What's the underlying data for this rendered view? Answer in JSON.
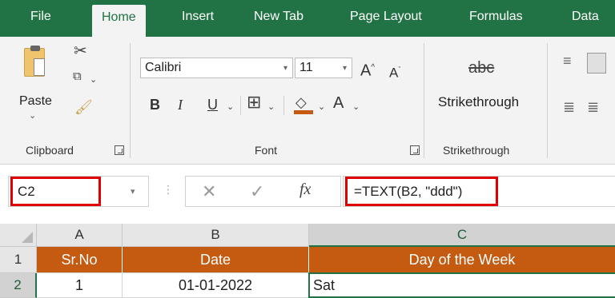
{
  "tabs": [
    {
      "label": "File",
      "active": false
    },
    {
      "label": "Home",
      "active": true
    },
    {
      "label": "Insert",
      "active": false
    },
    {
      "label": "New Tab",
      "active": false
    },
    {
      "label": "Page Layout",
      "active": false
    },
    {
      "label": "Formulas",
      "active": false
    },
    {
      "label": "Data",
      "active": false
    }
  ],
  "ribbon": {
    "clipboard": {
      "paste_label": "Paste",
      "group_label": "Clipboard"
    },
    "font": {
      "font_name": "Calibri",
      "font_size": "11",
      "group_label": "Font",
      "bold": "B",
      "italic": "I",
      "underline": "U",
      "grow": "A",
      "shrink": "A",
      "font_color": "A"
    },
    "strikethrough": {
      "icon_text": "abc",
      "button_label": "Strikethrough",
      "group_label": "Strikethrough"
    }
  },
  "formula_bar": {
    "name_box": "C2",
    "fx": "fx",
    "formula": "=TEXT(B2, \"ddd\")"
  },
  "grid": {
    "columns": [
      "A",
      "B",
      "C"
    ],
    "rows": [
      "1",
      "2"
    ],
    "header_row": [
      "Sr.No",
      "Date",
      "Day of the Week"
    ],
    "data_row": [
      "1",
      "01-01-2022",
      "Sat"
    ]
  },
  "colors": {
    "accent": "#217346",
    "header_fill": "#c55a11",
    "highlight_box": "#e00000"
  }
}
